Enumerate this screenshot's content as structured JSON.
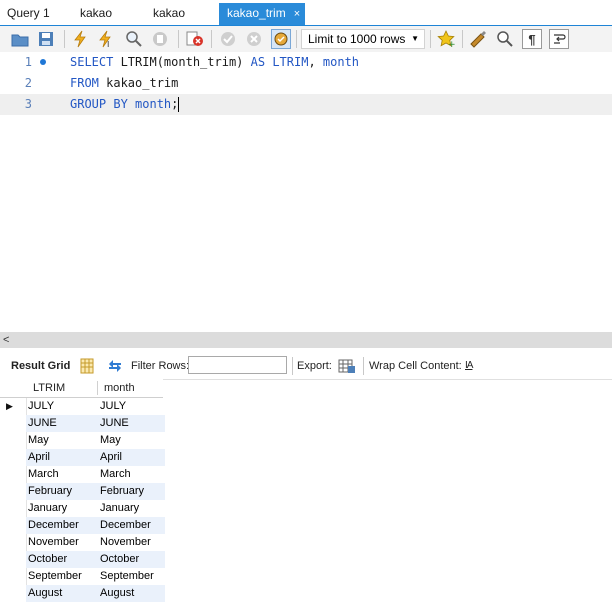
{
  "tabs": [
    {
      "label": "Query 1"
    },
    {
      "label": "kakao"
    },
    {
      "label": "kakao"
    },
    {
      "label": "kakao_trim",
      "active": true
    }
  ],
  "tab_close": "×",
  "toolbar": {
    "limit_value": "Limit to 1000 rows",
    "icons": [
      "open-folder-icon",
      "save-icon",
      "execute-icon",
      "execute-current-icon",
      "explain-icon",
      "stop-icon",
      "toggle-error-icon",
      "commit-icon",
      "rollback-icon",
      "autocommit-icon",
      "beautify-icon",
      "favorite-icon",
      "find-icon",
      "invisible-chars-icon",
      "wrap-icon"
    ]
  },
  "editor": {
    "lines": [
      {
        "num": "1",
        "tokens": [
          [
            "kw",
            "SELECT "
          ],
          [
            "tx",
            "LTRIM"
          ],
          [
            "tx",
            "(month_trim) "
          ],
          [
            "kw",
            "AS "
          ],
          [
            "kw",
            "LTRIM"
          ],
          [
            "tx",
            ", "
          ],
          [
            "kw",
            "month"
          ]
        ]
      },
      {
        "num": "2",
        "tokens": [
          [
            "kw",
            "FROM "
          ],
          [
            "tx",
            "kakao_trim"
          ]
        ]
      },
      {
        "num": "3",
        "tokens": [
          [
            "kw",
            "GROUP BY "
          ],
          [
            "kw",
            "month"
          ],
          [
            "tx",
            ";"
          ]
        ]
      }
    ]
  },
  "scroll_left": "<",
  "result_bar": {
    "result_grid": "Result Grid",
    "filter_rows": "Filter Rows:",
    "export": "Export:",
    "wrap": "Wrap Cell Content:",
    "wrap_icon_text": "IA"
  },
  "grid": {
    "columns": [
      "LTRIM",
      "month"
    ],
    "rows": [
      [
        "JULY",
        "JULY"
      ],
      [
        "JUNE",
        "JUNE"
      ],
      [
        "May",
        "May"
      ],
      [
        "April",
        "April"
      ],
      [
        "March",
        "March"
      ],
      [
        "February",
        "February"
      ],
      [
        "January",
        "January"
      ],
      [
        "December",
        "December"
      ],
      [
        "November",
        "November"
      ],
      [
        "October",
        "October"
      ],
      [
        "September",
        "September"
      ],
      [
        "August",
        "August"
      ]
    ]
  }
}
